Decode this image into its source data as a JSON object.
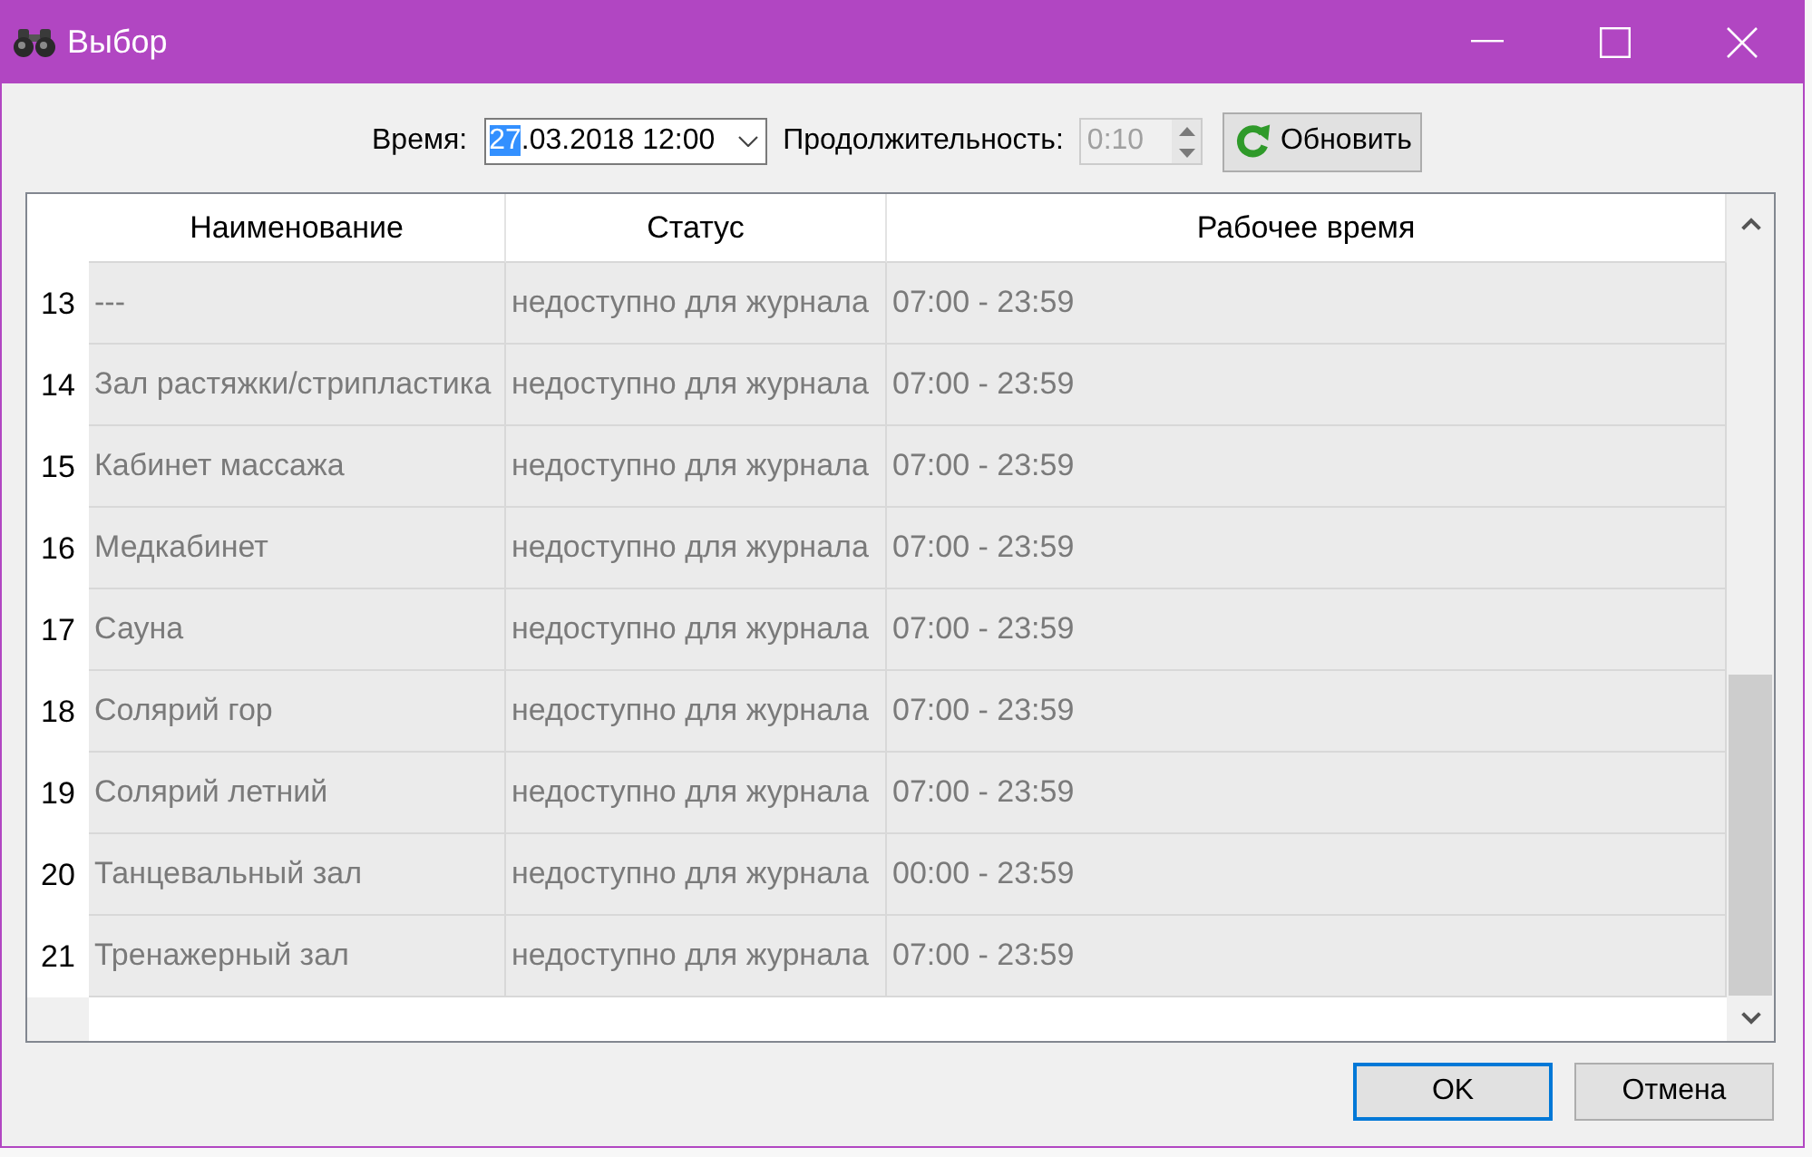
{
  "window": {
    "title": "Выбор"
  },
  "toolbar": {
    "time_label": "Время:",
    "date": {
      "value_parts": [
        {
          "text": "27",
          "selected": true
        },
        {
          "text": ".03.2018 12:00",
          "selected": false
        }
      ]
    },
    "duration_label": "Продолжительность:",
    "duration": {
      "value": "0:10",
      "disabled": true
    },
    "refresh_button": "Обновить"
  },
  "table": {
    "columns": [
      "Наименование",
      "Статус",
      "Рабочее время"
    ],
    "rows": [
      {
        "number": "13",
        "name": "---",
        "status": "недоступно для журнала",
        "hours": "07:00 - 23:59",
        "disabled": true
      },
      {
        "number": "14",
        "name": "Зал растяжки/стрипластика",
        "status": "недоступно для журнала",
        "hours": "07:00 - 23:59",
        "disabled": true
      },
      {
        "number": "15",
        "name": "Кабинет массажа",
        "status": "недоступно для журнала",
        "hours": "07:00 - 23:59",
        "disabled": true
      },
      {
        "number": "16",
        "name": "Медкабинет",
        "status": "недоступно для журнала",
        "hours": "07:00 - 23:59",
        "disabled": true
      },
      {
        "number": "17",
        "name": "Сауна",
        "status": "недоступно для журнала",
        "hours": "07:00 - 23:59",
        "disabled": true
      },
      {
        "number": "18",
        "name": "Солярий гор",
        "status": "недоступно для журнала",
        "hours": "07:00 - 23:59",
        "disabled": true
      },
      {
        "number": "19",
        "name": "Солярий летний",
        "status": "недоступно для журнала",
        "hours": "07:00 - 23:59",
        "disabled": true
      },
      {
        "number": "20",
        "name": "Танцевальный зал",
        "status": "недоступно для журнала",
        "hours": "00:00 - 23:59",
        "disabled": true
      },
      {
        "number": "21",
        "name": "Тренажерный зал",
        "status": "недоступно для журнала",
        "hours": "07:00 - 23:59",
        "disabled": true
      }
    ]
  },
  "buttons": [
    {
      "label": "OK",
      "default": true
    },
    {
      "label": "Отмена",
      "default": false
    }
  ]
}
